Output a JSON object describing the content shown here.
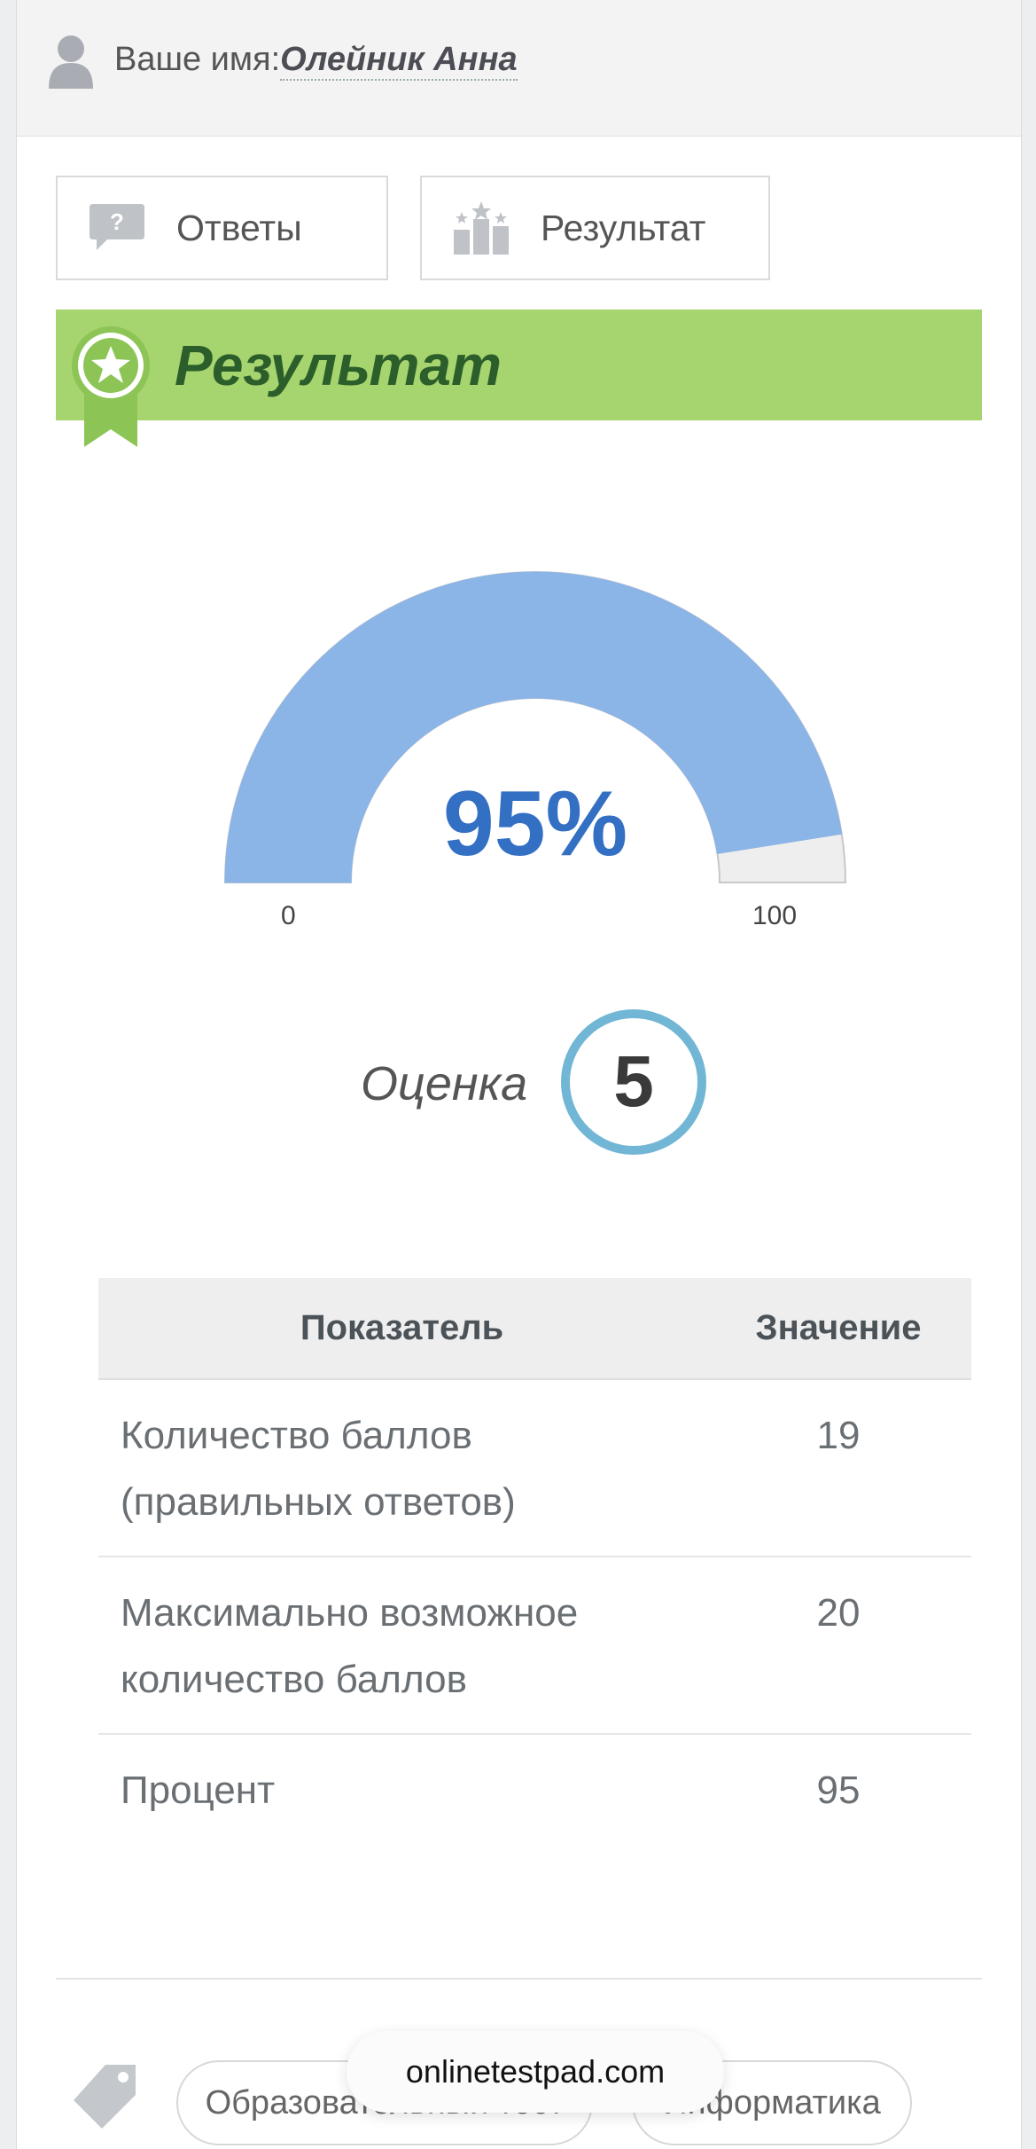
{
  "user": {
    "label": "Ваше имя:",
    "name": "Олейник Анна"
  },
  "tabs": [
    {
      "label": "Ответы",
      "icon": "question-bubble-icon"
    },
    {
      "label": "Результат",
      "icon": "podium-icon"
    }
  ],
  "result": {
    "title": "Результат",
    "icon": "award-badge-icon",
    "banner_color": "#a6d46e"
  },
  "gauge": {
    "value_text": "95%",
    "value_fraction": 0.95,
    "min_label": "0",
    "max_label": "100",
    "fill_color": "#8bb4e7",
    "track_color": "#eeeeee",
    "text_color": "#3370c4"
  },
  "grade": {
    "label": "Оценка",
    "value": "5",
    "ring_color": "#72b6d6"
  },
  "table": {
    "headers": [
      "Показатель",
      "Значение"
    ],
    "rows": [
      {
        "line1": "Количество баллов",
        "line2": "(правильных ответов)",
        "value": "19"
      },
      {
        "line1": "Максимально возможное",
        "line2": "количество баллов",
        "value": "20"
      },
      {
        "line1": "Процент",
        "value": "95"
      }
    ]
  },
  "footer": {
    "tag_icon": "tag-icon",
    "chips": [
      "Образовательный тест",
      "Информатика"
    ],
    "site": "onlinetestpad.com"
  }
}
